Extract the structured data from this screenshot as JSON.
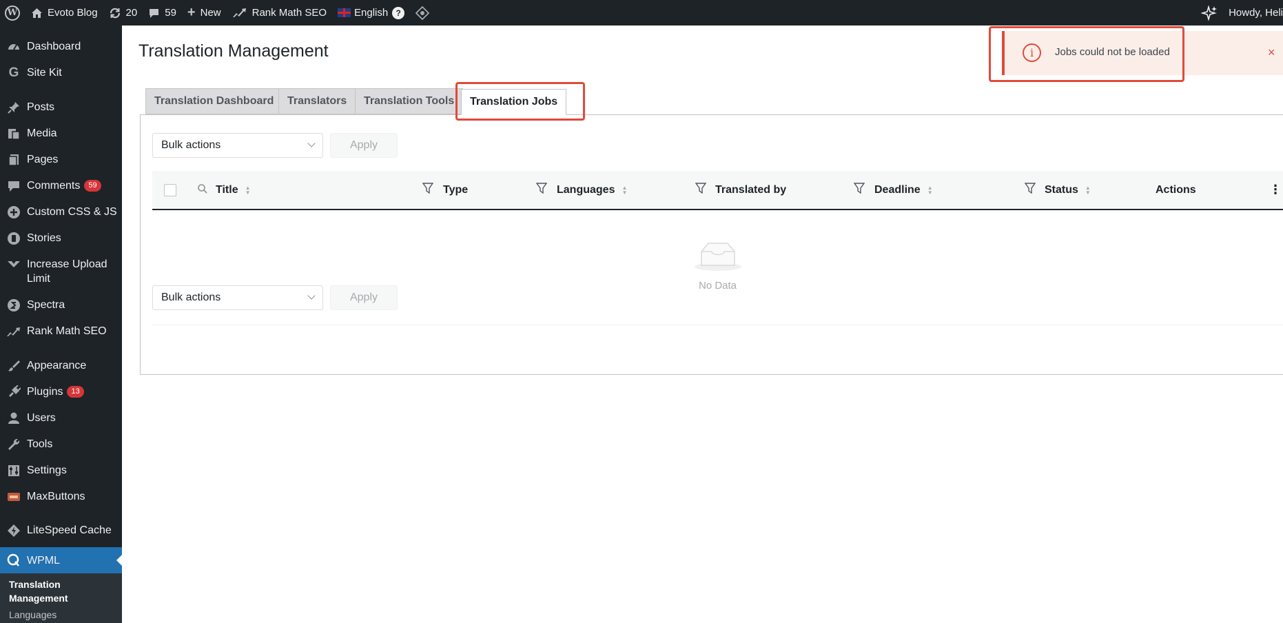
{
  "adminbar": {
    "site_name": "Evoto Blog",
    "updates_count": "20",
    "comments_count": "59",
    "new_label": "New",
    "seo_label": "Rank Math SEO",
    "language_label": "English",
    "help_symbol": "?",
    "howdy": "Howdy, Heli"
  },
  "sidebar": {
    "items": [
      {
        "label": "Dashboard",
        "icon": "dashboard-icon"
      },
      {
        "label": "Site Kit",
        "icon": "google-icon"
      },
      {
        "label": "Posts",
        "icon": "pin-icon"
      },
      {
        "label": "Media",
        "icon": "media-icon"
      },
      {
        "label": "Pages",
        "icon": "pages-icon"
      },
      {
        "label": "Comments",
        "icon": "comment-icon",
        "badge": "59"
      },
      {
        "label": "Custom CSS & JS",
        "icon": "plus-circle-icon"
      },
      {
        "label": "Stories",
        "icon": "stories-icon"
      },
      {
        "label": "Increase Upload Limit",
        "icon": "upload-icon"
      },
      {
        "label": "Spectra",
        "icon": "spectra-icon"
      },
      {
        "label": "Rank Math SEO",
        "icon": "rankmath-icon"
      },
      {
        "label": "Appearance",
        "icon": "brush-icon"
      },
      {
        "label": "Plugins",
        "icon": "plugin-icon",
        "badge": "13"
      },
      {
        "label": "Users",
        "icon": "user-icon"
      },
      {
        "label": "Tools",
        "icon": "wrench-icon"
      },
      {
        "label": "Settings",
        "icon": "settings-icon"
      },
      {
        "label": "MaxButtons",
        "icon": "maxbuttons-icon"
      },
      {
        "label": "LiteSpeed Cache",
        "icon": "litespeed-icon"
      },
      {
        "label": "WPML",
        "icon": "wpml-icon"
      }
    ],
    "submenu": {
      "current": "Translation Management",
      "next": "Languages"
    }
  },
  "main": {
    "title": "Translation Management",
    "tabs": [
      {
        "label": "Translation Dashboard"
      },
      {
        "label": "Translators"
      },
      {
        "label": "Translation Tools"
      },
      {
        "label": "Translation Jobs"
      }
    ],
    "bulk_actions": "Bulk actions",
    "apply": "Apply",
    "columns": {
      "title": "Title",
      "type": "Type",
      "languages": "Languages",
      "translated_by": "Translated by",
      "deadline": "Deadline",
      "status": "Status",
      "actions": "Actions"
    },
    "empty_text": "No Data"
  },
  "toast": {
    "message": "Jobs could not be loaded",
    "icon_glyph": "i",
    "close_glyph": "×"
  },
  "colors": {
    "accent": "#2271b1",
    "error": "#e04a3a",
    "adminbar_bg": "#1d2327"
  }
}
